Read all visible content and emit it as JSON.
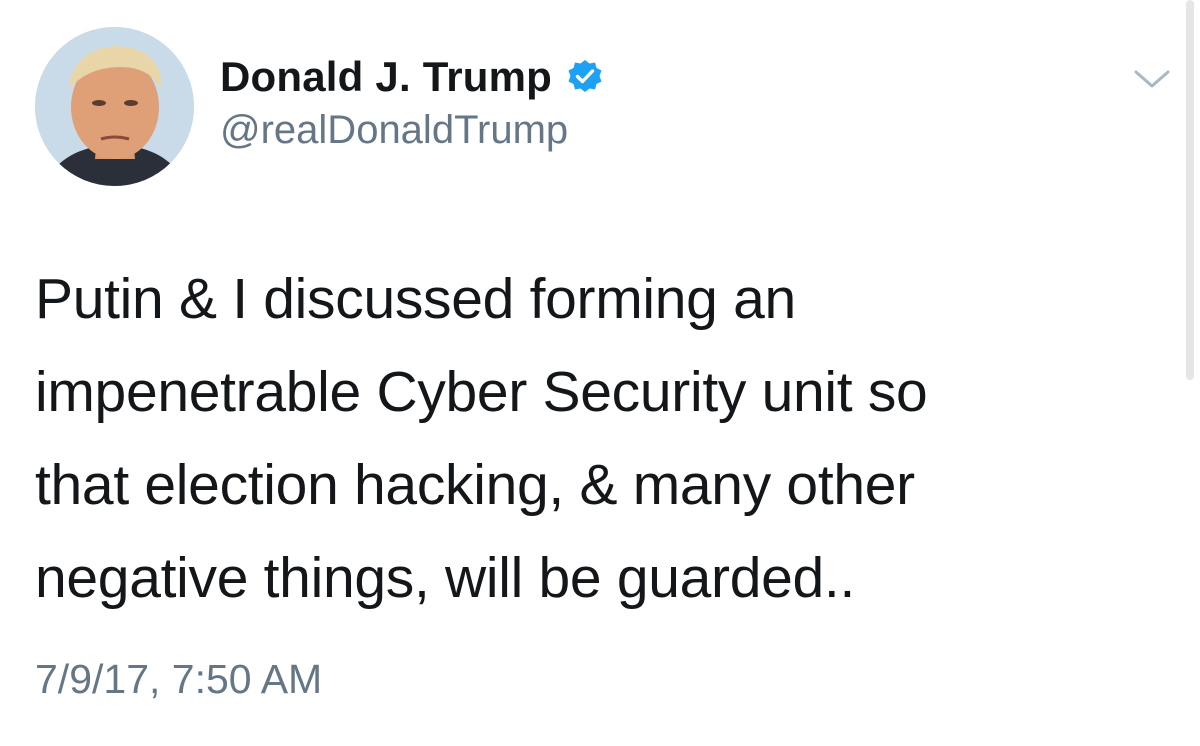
{
  "author": {
    "display_name": "Donald J. Trump",
    "handle": "@realDonaldTrump",
    "verified": true,
    "avatar_icon": "profile-photo",
    "verified_icon": "verified-badge-icon"
  },
  "tweet": {
    "text": "Putin & I discussed forming an\nimpenetrable Cyber Security unit    so\nthat election hacking, & many other\nnegative things, will be guarded..",
    "timestamp": "7/9/17, 7:50 AM"
  },
  "menu": {
    "icon": "chevron-down-icon"
  },
  "colors": {
    "text_primary": "#14171a",
    "text_secondary": "#657786",
    "verified_blue": "#1da1f2",
    "background": "#ffffff"
  }
}
